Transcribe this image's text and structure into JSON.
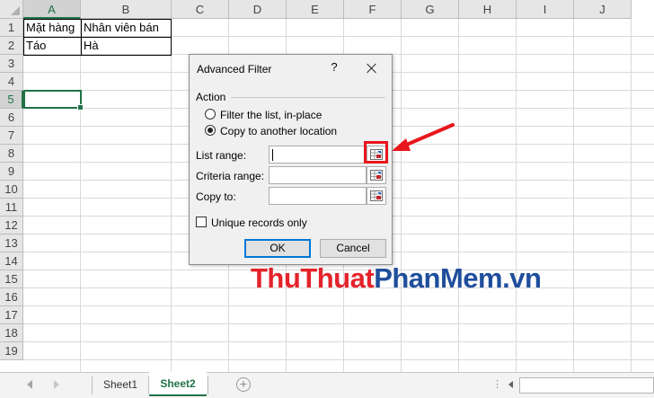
{
  "spreadsheet": {
    "columns": [
      "A",
      "B",
      "C",
      "D",
      "E",
      "F",
      "G",
      "H",
      "I",
      "J"
    ],
    "rows": [
      "1",
      "2",
      "3",
      "4",
      "5",
      "6",
      "7",
      "8",
      "9",
      "10",
      "11",
      "12",
      "13",
      "14",
      "15",
      "16",
      "17",
      "18",
      "19"
    ],
    "active_cell": "A5",
    "cells": {
      "a1": "Mặt hàng",
      "b1": "Nhân viên bán",
      "a2": "Táo",
      "b2": "Hà"
    }
  },
  "dialog": {
    "title": "Advanced Filter",
    "help": "?",
    "action_label": "Action",
    "options": [
      "Filter the list, in-place",
      "Copy to another location"
    ],
    "selected_option": "Copy to another location",
    "list_range_label": "List range:",
    "list_range_value": "",
    "criteria_range_label": "Criteria range:",
    "criteria_range_value": "",
    "copy_to_label": "Copy to:",
    "copy_to_value": "",
    "unique_label": "Unique records only",
    "unique_checked": false,
    "ok": "OK",
    "cancel": "Cancel"
  },
  "watermark": {
    "part1": "Thu",
    "part2": "Thuat",
    "part3": "PhanMem",
    "part4": ".vn"
  },
  "sheet_tabs": {
    "tabs": [
      "Sheet1",
      "Sheet2"
    ],
    "active": "Sheet2",
    "add_symbol": "+",
    "more": "⋮"
  },
  "colors": {
    "excel_green": "#217346",
    "annotation_red": "#e8171d",
    "watermark_red": "#e4232a",
    "watermark_blue": "#1f4e9c"
  }
}
